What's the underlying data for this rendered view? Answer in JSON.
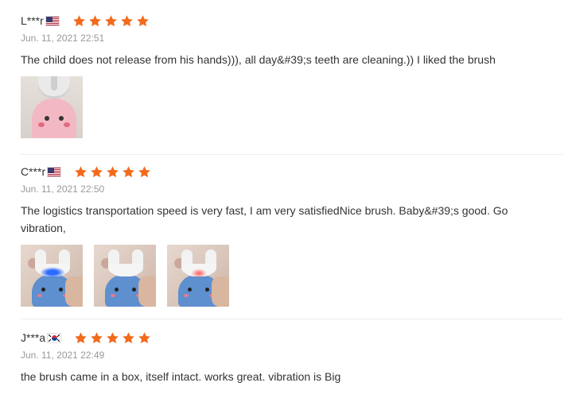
{
  "reviews": [
    {
      "user": "L***r",
      "country": "US",
      "flag_icon": "us-flag-icon",
      "rating": 5,
      "date": "Jun. 11, 2021 22:51",
      "text": "The child does not release from his hands))), all day&#39;s teeth are cleaning.)) I liked the brush",
      "photos": 1
    },
    {
      "user": "C***r",
      "country": "US",
      "flag_icon": "us-flag-icon",
      "rating": 5,
      "date": "Jun. 11, 2021 22:50",
      "text": "The logistics transportation speed is very fast, I am very satisfiedNice brush. Baby&#39;s good. Go vibration,",
      "photos": 3
    },
    {
      "user": "J***a",
      "country": "KR",
      "flag_icon": "kr-flag-icon",
      "rating": 5,
      "date": "Jun. 11, 2021 22:49",
      "text": "the brush came in a box, itself intact. works great. vibration is Big",
      "photos": 0
    }
  ],
  "colors": {
    "star": "#f26b1d",
    "date": "#999999",
    "text": "#333333"
  }
}
